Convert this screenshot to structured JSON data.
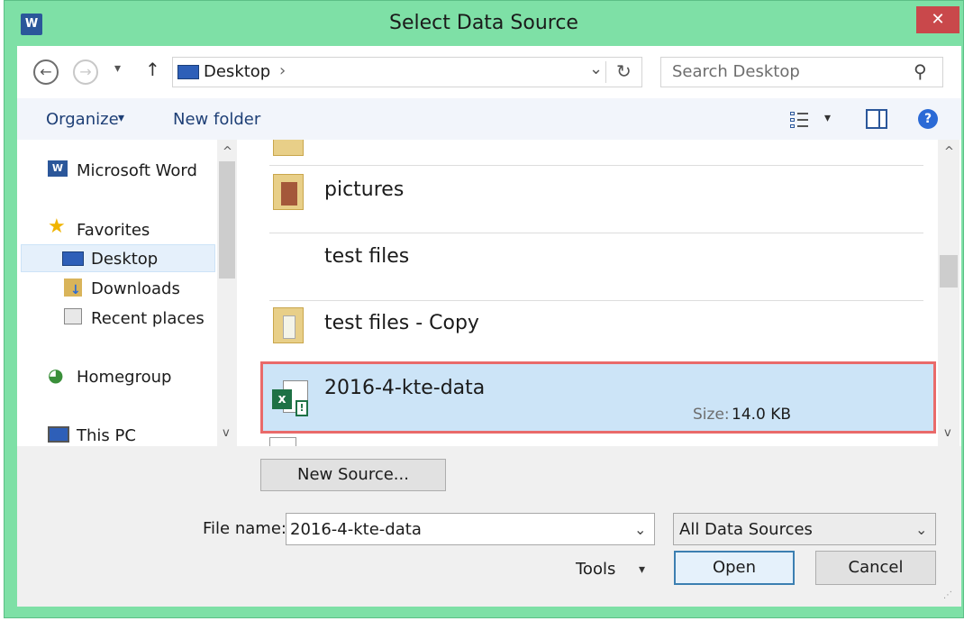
{
  "window": {
    "title": "Select Data Source",
    "close_glyph": "✕",
    "app_icon": "W"
  },
  "nav": {
    "back_glyph": "←",
    "forward_glyph": "→",
    "recent_glyph": "▾",
    "up_glyph": "↑",
    "address": "Desktop",
    "address_arrow": "›",
    "address_dropdown_glyph": "⌄",
    "refresh_glyph": "↻",
    "search_placeholder": "Search Desktop",
    "search_glyph": "⚲"
  },
  "toolbar": {
    "organize": "Organize",
    "organize_arrow": "▾",
    "new_folder": "New folder",
    "view_arrow": "▾",
    "help_glyph": "?"
  },
  "sidebar": {
    "items": [
      {
        "label": "Microsoft Word",
        "icon": "word-icon"
      },
      {
        "label": "Favorites",
        "icon": "star-icon"
      },
      {
        "label": "Desktop",
        "icon": "desktop-icon"
      },
      {
        "label": "Downloads",
        "icon": "downloads-icon"
      },
      {
        "label": "Recent places",
        "icon": "recent-places-icon"
      },
      {
        "label": "Homegroup",
        "icon": "homegroup-icon"
      },
      {
        "label": "This PC",
        "icon": "pc-icon"
      }
    ],
    "scroll_up": "^",
    "scroll_down": "v"
  },
  "files": {
    "items": [
      {
        "name": "pictures",
        "icon": "folder-icon"
      },
      {
        "name": "test files",
        "icon": "none"
      },
      {
        "name": "test files - Copy",
        "icon": "folder-icon"
      },
      {
        "name": "2016-4-kte-data",
        "icon": "excel-icon",
        "size_label": "Size:",
        "size_value": "14.0 KB"
      }
    ],
    "scroll_up": "^",
    "scroll_down": "v"
  },
  "footer": {
    "new_source": "New Source...",
    "file_name_label": "File name:",
    "file_name_value": "2016-4-kte-data",
    "file_type": "All Data Sources",
    "tools": "Tools",
    "tools_arrow": "▾",
    "open": "Open",
    "cancel": "Cancel"
  },
  "colors": {
    "frame": "#7ee0a6",
    "close": "#c9484b",
    "selection": "#cce4f7",
    "selection_border": "#e96a6a",
    "link": "#1e3f76"
  }
}
